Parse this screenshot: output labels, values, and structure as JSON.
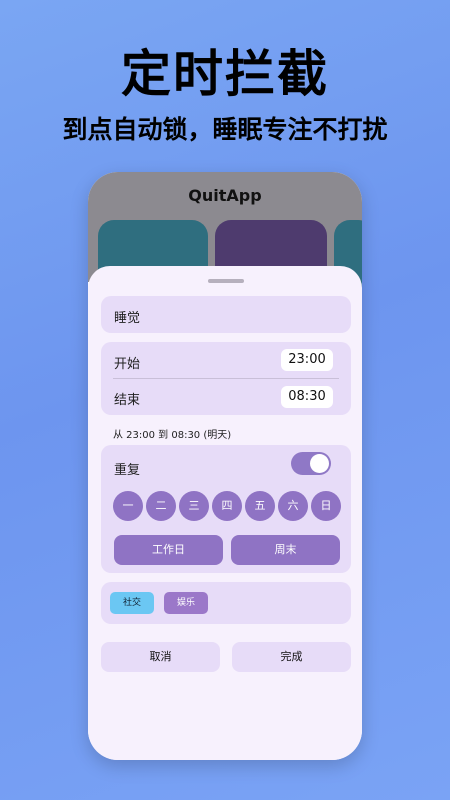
{
  "promo": {
    "headline": "定时拦截",
    "subline": "到点自动锁，睡眠专注不打扰"
  },
  "app": {
    "title": "QuitApp"
  },
  "schedule": {
    "name": "睡觉",
    "start_label": "开始",
    "start_time": "23:00",
    "end_label": "结束",
    "end_time": "08:30",
    "range_text": "从 23:00 到 08:30 (明天)"
  },
  "repeat": {
    "label": "重复",
    "enabled": true,
    "days": [
      "一",
      "二",
      "三",
      "四",
      "五",
      "六",
      "日"
    ],
    "presets": [
      "工作日",
      "周末"
    ]
  },
  "tags": [
    "社交",
    "娱乐"
  ],
  "colors": {
    "accent": "#8f73c4",
    "card": "#e7dcf8",
    "social_tag": "#6bc7f3"
  },
  "actions": {
    "cancel": "取消",
    "done": "完成"
  }
}
